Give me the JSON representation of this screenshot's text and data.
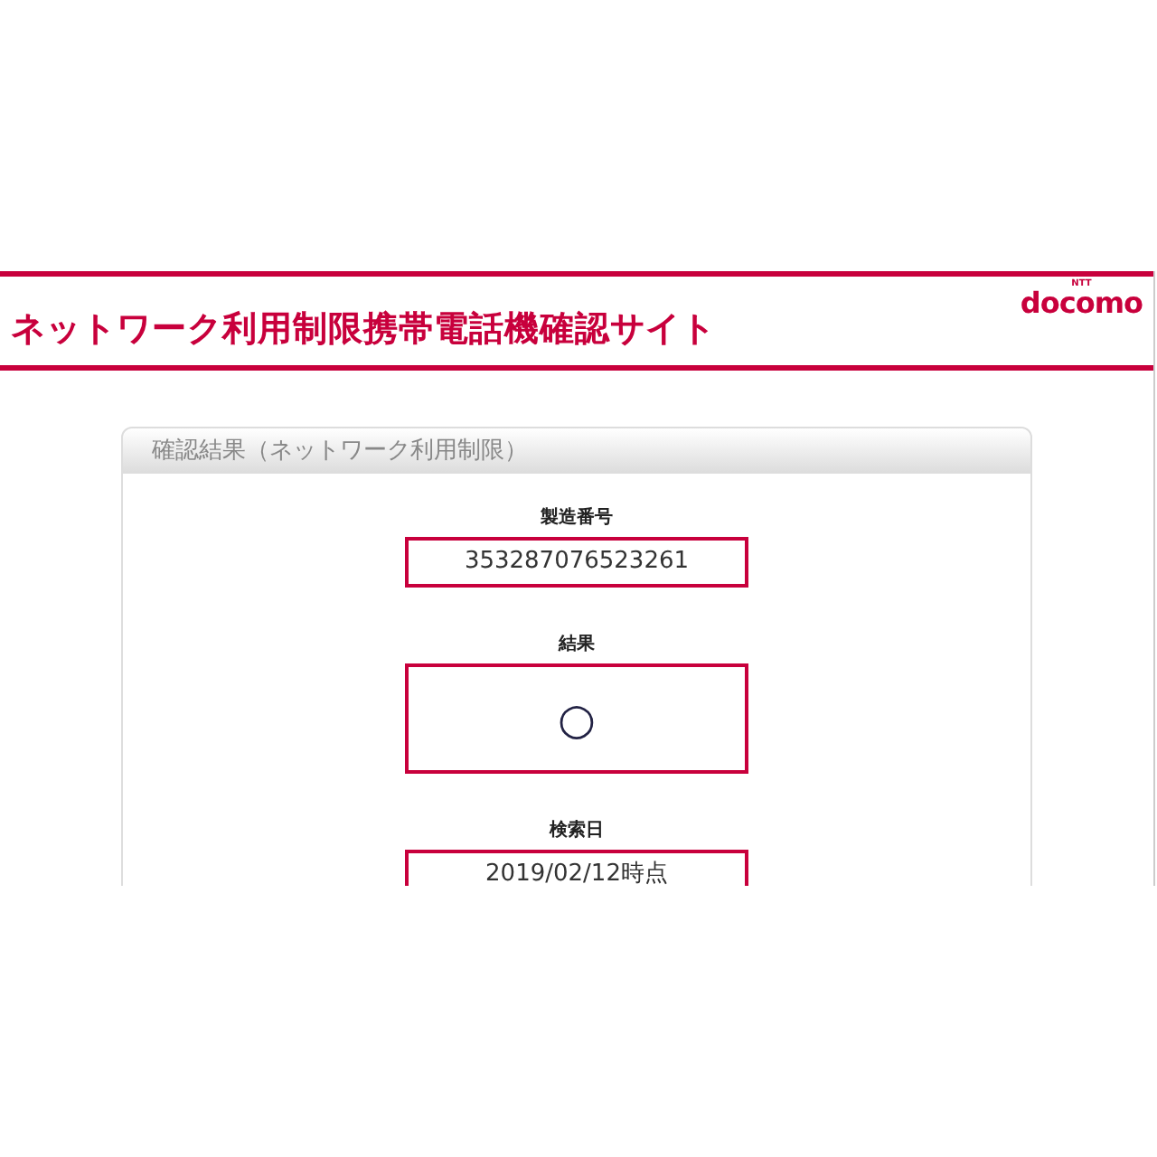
{
  "header": {
    "title": "ネットワーク利用制限携帯電話機確認サイト",
    "logo_small": "NTT",
    "logo": "docomo"
  },
  "panel": {
    "title": "確認結果（ネットワーク利用制限）",
    "fields": [
      {
        "label": "製造番号",
        "value": "353287076523261",
        "kind": "text"
      },
      {
        "label": "結果",
        "value": "○",
        "kind": "result"
      },
      {
        "label": "検索日",
        "value": "2019/02/12時点",
        "kind": "text"
      }
    ]
  }
}
